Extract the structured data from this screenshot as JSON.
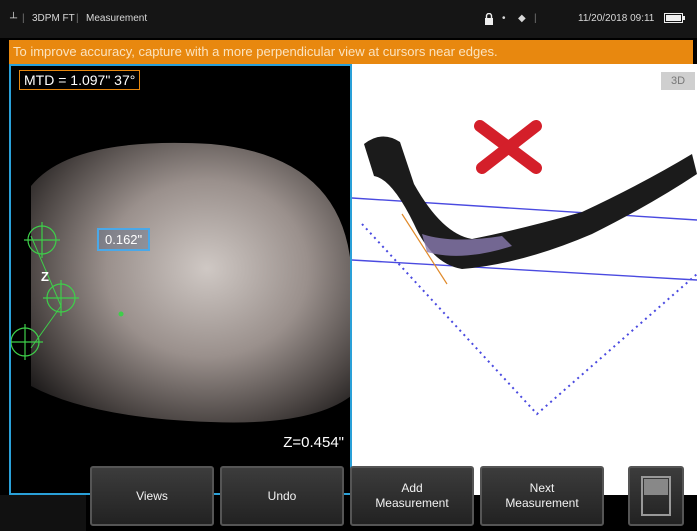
{
  "statusbar": {
    "app_label": "3DPM FT",
    "mode_label": "Measurement",
    "datetime": "11/20/2018 09:11"
  },
  "warning": "To improve accuracy, capture with a more perpendicular view at cursors near edges.",
  "left_view": {
    "mtd_readout": "MTD = 1.097\" 37°",
    "depth_label": "0.162\"",
    "z_marker": "Z",
    "z_readout": "Z=0.454\""
  },
  "right_view": {
    "badge": "3D",
    "error_mark_color": "#d41f2a",
    "line_color": "#4a4ae0"
  },
  "toolbar": {
    "views_label": "Views",
    "undo_label": "Undo",
    "add_label": "Add\nMeasurement",
    "next_label": "Next\nMeasurement"
  },
  "colors": {
    "accent_orange": "#e8880f",
    "focus_blue": "#2aa0d8",
    "cursor_green": "#3ecf4a"
  }
}
